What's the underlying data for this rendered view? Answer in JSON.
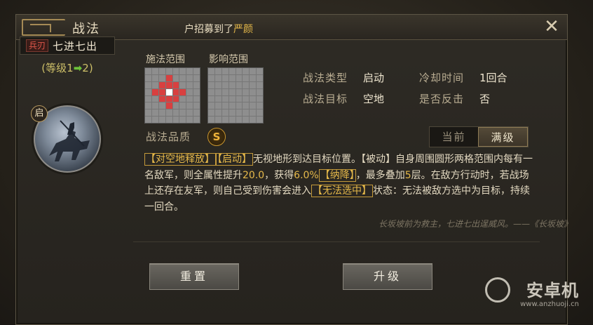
{
  "header": {
    "title": "战法",
    "notice_prefix": "户招募到了",
    "notice_highlight": "严颜"
  },
  "skill": {
    "type_tag": "兵刃",
    "name": "七进七出",
    "level_prefix": "(等级1",
    "level_suffix": "2)",
    "portrait_badge": "启"
  },
  "ranges": {
    "cast_label": "施法范围",
    "effect_label": "影响范围"
  },
  "info": {
    "type_label": "战法类型",
    "type_value": "启动",
    "cooldown_label": "冷却时间",
    "cooldown_value": "1回合",
    "target_label": "战法目标",
    "target_value": "空地",
    "counter_label": "是否反击",
    "counter_value": "否"
  },
  "quality": {
    "label": "战法品质",
    "grade": "S"
  },
  "toggle": {
    "current": "当前",
    "max": "满级"
  },
  "description": {
    "p1": "【对空地释放】",
    "p2": "【启动】",
    "p3": "无视地形到达目标位置。【被动】自身周围圆形两格范围内每有一名敌军，则全属性提升",
    "n1": "20.0",
    "p4": "，获得",
    "n2": "6.0%",
    "p5": "【纳降】",
    "p6": "，最多叠加",
    "n3": "5",
    "p7": "层。在敌方行动时，若战场上还存在友军，则自己受到伤害会进入",
    "p8": "【无法选中】",
    "p9": "状态：无法被敌方选中为目标，持续一回合。",
    "quote": "长坂坡前为救主，七进七出逞威风。——《长坂坡》"
  },
  "buttons": {
    "reset": "重置",
    "upgrade": "升级"
  },
  "watermark": {
    "brand": "安卓机",
    "url": "www.anzhuoji.cn"
  },
  "colors": {
    "accent_gold": "#e6b94a",
    "range_red": "#d84040",
    "level_green": "#6cc23a"
  }
}
